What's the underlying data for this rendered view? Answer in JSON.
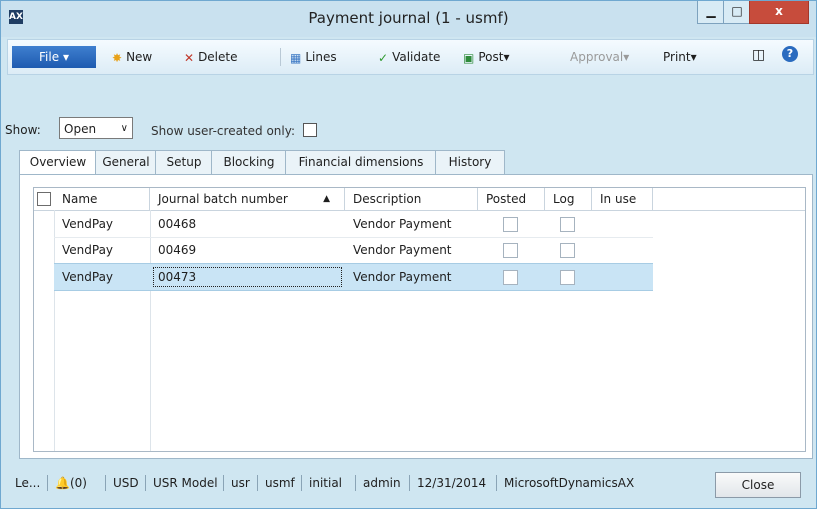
{
  "window": {
    "title": "Payment journal (1 - usmf)",
    "minimize": "▁",
    "maximize": "□",
    "close": "x"
  },
  "actionbar": {
    "file": "File",
    "new": "New",
    "delete": "Delete",
    "lines": "Lines",
    "validate": "Validate",
    "post": "Post",
    "approval": "Approval",
    "print": "Print",
    "icons": {
      "new": "new-star-icon",
      "delete": "delete-x-icon",
      "lines": "lines-grid-icon",
      "validate": "checkmark-icon",
      "post": "post-icon",
      "layout": "layout-icon",
      "help": "help-icon"
    }
  },
  "filter": {
    "show_label": "Show:",
    "show_value": "Open",
    "user_created_label": "Show user-created only:"
  },
  "tabs": [
    "Overview",
    "General",
    "Setup",
    "Blocking",
    "Financial dimensions",
    "History"
  ],
  "grid": {
    "columns": {
      "name": "Name",
      "batch": "Journal batch number",
      "description": "Description",
      "posted": "Posted",
      "log": "Log",
      "inuse": "In use"
    },
    "rows": [
      {
        "name": "VendPay",
        "batch": "00468",
        "description": "Vendor Payment"
      },
      {
        "name": "VendPay",
        "batch": "00469",
        "description": "Vendor Payment"
      },
      {
        "name": "VendPay",
        "batch": "00473",
        "description": "Vendor Payment"
      }
    ]
  },
  "statusbar": {
    "le": "Le...",
    "notifications": "(0)",
    "currency": "USD",
    "model": "USR Model",
    "layer": "usr",
    "company": "usmf",
    "partition": "initial",
    "user": "admin",
    "date": "12/31/2014",
    "server": "MicrosoftDynamicsAX",
    "close": "Close"
  },
  "colors": {
    "accent": "#1e5bb0",
    "selection": "#c9e4f5",
    "close": "#c74c3c"
  }
}
